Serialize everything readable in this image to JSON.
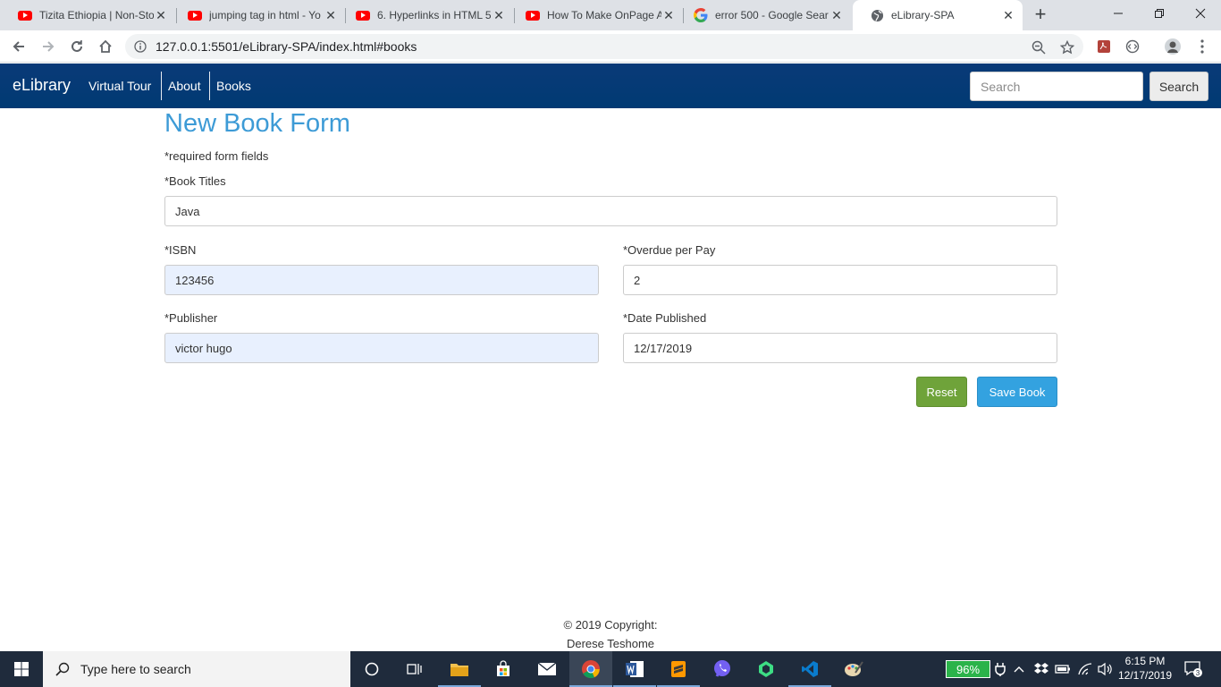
{
  "browser": {
    "tabs": [
      {
        "title": "Tizita Ethiopia | Non-Sto",
        "icon": "youtube-icon",
        "active": false
      },
      {
        "title": "jumping tag in html - Yo",
        "icon": "youtube-icon",
        "active": false
      },
      {
        "title": "6. Hyperlinks in HTML 5",
        "icon": "youtube-icon",
        "active": false
      },
      {
        "title": "How To Make OnPage A",
        "icon": "youtube-icon",
        "active": false
      },
      {
        "title": "error 500 - Google Sear",
        "icon": "google-icon",
        "active": false
      },
      {
        "title": "eLibrary-SPA",
        "icon": "globe-icon",
        "active": true
      }
    ],
    "url": "127.0.0.1:5501/eLibrary-SPA/index.html#books"
  },
  "navbar": {
    "brand": "eLibrary",
    "links": [
      "Virtual Tour",
      "About",
      "Books"
    ],
    "search_placeholder": "Search",
    "search_button": "Search",
    "bg_color": "#003a73"
  },
  "form": {
    "title": "New Book Form",
    "required_note": "*required form fields",
    "fields": {
      "book_title": {
        "label": "*Book Titles",
        "value": "Java"
      },
      "isbn": {
        "label": "*ISBN",
        "value": "123456"
      },
      "overdue": {
        "label": "*Overdue per Pay",
        "value": "2"
      },
      "publisher": {
        "label": "*Publisher",
        "value": "victor hugo"
      },
      "date_published": {
        "label": "*Date Published",
        "value": "12/17/2019"
      }
    },
    "reset_label": "Reset",
    "save_label": "Save Book",
    "title_color": "#3d9bd6",
    "reset_color": "#6fa33a",
    "save_color": "#33a2e0"
  },
  "footer": {
    "line1": "© 2019 Copyright:",
    "line2": "Derese Teshome"
  },
  "taskbar": {
    "search_placeholder": "Type here to search",
    "battery": "96%",
    "time": "6:15 PM",
    "date": "12/17/2019",
    "notifications": "3"
  }
}
